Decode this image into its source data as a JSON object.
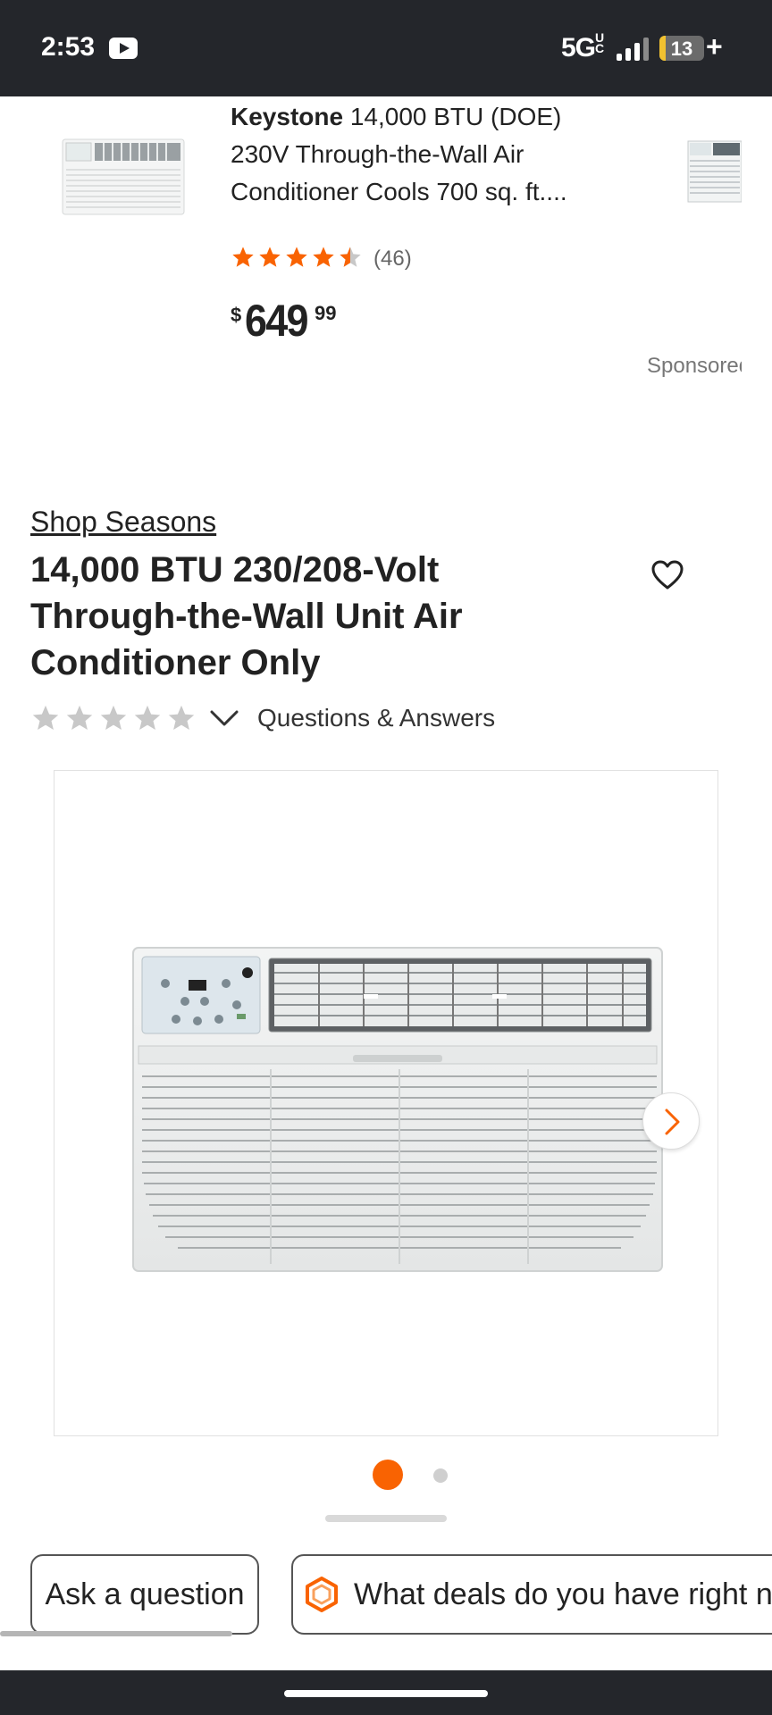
{
  "status_bar": {
    "time": "2:53",
    "network": "5G",
    "network_suffix": "UC",
    "battery_level": "13",
    "icons": [
      "youtube-icon",
      "signal-icon",
      "battery-icon",
      "charging-plus-icon"
    ]
  },
  "sponsored": {
    "brand": "Keystone",
    "title_rest": " 14,000 BTU (DOE)\n230V Through-the-Wall Air\nConditioner Cools 700 sq. ft....",
    "rating": 4.5,
    "review_count": "(46)",
    "price_symbol": "$",
    "price_dollars": "649",
    "price_cents": "99",
    "label": "Sponsored"
  },
  "product": {
    "brand_link": "Shop Seasons",
    "title": "14,000 BTU 230/208-Volt\nThrough-the-Wall Unit Air\nConditioner Only",
    "rating": 0,
    "qa_link": "Questions & Answers",
    "gallery": {
      "current_index": 0,
      "count": 2
    }
  },
  "chips": {
    "ask_question": "Ask a question",
    "deals_question": "What deals do you have right now"
  },
  "colors": {
    "accent": "#f96302",
    "status_bar_bg": "#24262b",
    "star_empty": "#c8c8c8",
    "battery_fill": "#f2c230"
  }
}
